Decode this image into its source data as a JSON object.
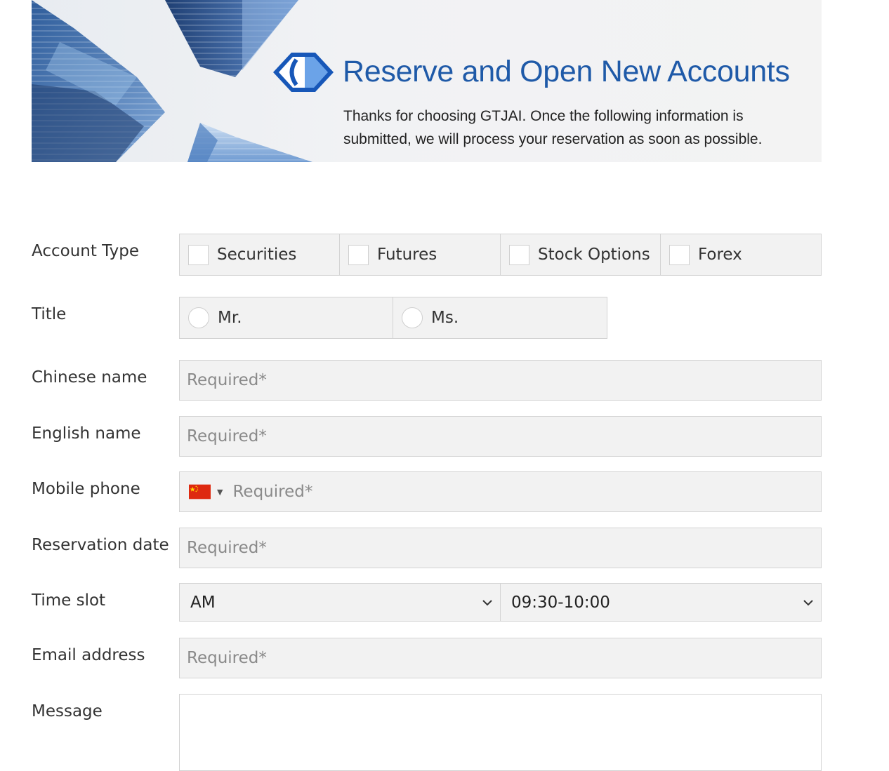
{
  "banner": {
    "title": "Reserve and Open New Accounts",
    "description_line1": "Thanks for choosing GTJAI.  Once the following information is",
    "description_line2": "submitted, we will process your reservation as soon as possible.",
    "brand_color": "#1f5aa8"
  },
  "form": {
    "account_type": {
      "label": "Account Type",
      "options": [
        {
          "label": "Securities",
          "checked": false
        },
        {
          "label": "Futures",
          "checked": false
        },
        {
          "label": "Stock Options",
          "checked": false
        },
        {
          "label": "Forex",
          "checked": false
        }
      ]
    },
    "title": {
      "label": "Title",
      "options": [
        {
          "label": "Mr.",
          "selected": false
        },
        {
          "label": "Ms.",
          "selected": false
        }
      ]
    },
    "chinese_name": {
      "label": "Chinese name",
      "placeholder": "Required*",
      "value": ""
    },
    "english_name": {
      "label": "English name",
      "placeholder": "Required*",
      "value": ""
    },
    "mobile_phone": {
      "label": "Mobile phone",
      "placeholder": "Required*",
      "value": "",
      "country_flag": "china-flag-icon"
    },
    "reservation_date": {
      "label": "Reservation date",
      "placeholder": "Required*",
      "value": ""
    },
    "time_slot": {
      "label": "Time slot",
      "period": "AM",
      "time": "09:30-10:00"
    },
    "email": {
      "label": "Email address",
      "placeholder": "Required*",
      "value": ""
    },
    "message": {
      "label": "Message",
      "value": ""
    }
  },
  "colors": {
    "field_bg": "#f2f2f2",
    "field_border": "#d3d3d3",
    "placeholder": "#8a8a8a"
  }
}
